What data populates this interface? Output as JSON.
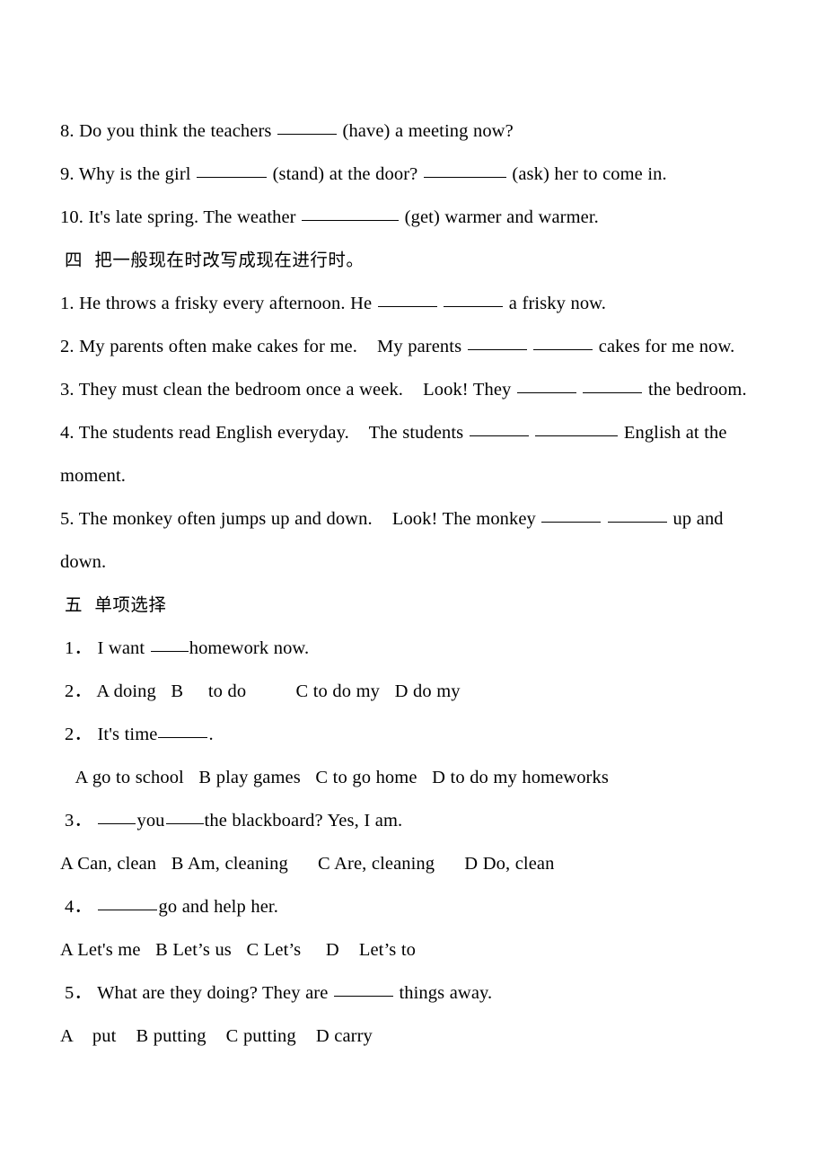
{
  "document": {
    "type": "english-grammar-worksheet",
    "language": "en-zh",
    "page_background": "#ffffff",
    "text_color": "#000000"
  },
  "fill_in_tail": {
    "q8": {
      "number": "8.",
      "text_before": "Do you think the teachers",
      "cue_after": "(have) a meeting now?"
    },
    "q9": {
      "number": "9.",
      "text_before": "Why is the girl",
      "cue_mid": "(stand) at the door?",
      "cue_after": "(ask) her to come in."
    },
    "q10": {
      "number": "10.",
      "text_before": "It's late spring. The weather",
      "cue_after": "(get) warmer and warmer."
    }
  },
  "section_four": {
    "heading": "四  把一般现在时改写成现在进行时。",
    "items": [
      {
        "number": "1.",
        "stem": "He throws a frisky every afternoon. He",
        "tail": "a frisky now."
      },
      {
        "number": "2.",
        "stem": "My parents often make cakes for me.    My parents",
        "tail": "cakes for me now."
      },
      {
        "number": "3.",
        "stem": "They must clean the bedroom once a week.    Look! They",
        "tail": "the bedroom."
      },
      {
        "number": "4.",
        "stem": "The students read English everyday.    The students",
        "tail": "English at the",
        "wrap": "moment."
      },
      {
        "number": "5.",
        "stem": "The monkey often jumps up and down.    Look! The monkey",
        "tail": "up and",
        "wrap": "down."
      }
    ]
  },
  "section_five": {
    "heading": "五  单项选择",
    "items": [
      {
        "number": "1．",
        "stem_before": "I want",
        "stem_after": "homework now.",
        "choices_inline": null
      },
      {
        "number": "2．",
        "choices_line": "A doing   B     to do          C to do my   D do my"
      },
      {
        "number": "2．",
        "stem_before": "It's time",
        "stem_after": ".",
        "choices_line": " A go to school   B play games   C to go home   D to do my homeworks"
      },
      {
        "number": "3．",
        "stem_mid": "you",
        "stem_after": "the blackboard? Yes, I am.",
        "choices_line": "A Can, clean   B Am, cleaning      C Are, cleaning      D Do, clean"
      },
      {
        "number": "4．",
        "stem_after": "go and help her.",
        "choices_line": "A Let's me   B Let’s us   C Let’s     D    Let’s to"
      },
      {
        "number": "5．",
        "stem_before": "What are they doing? They are",
        "stem_after": "things away.",
        "choices_line": "A    put    B putting    C putting    D carry"
      }
    ]
  }
}
